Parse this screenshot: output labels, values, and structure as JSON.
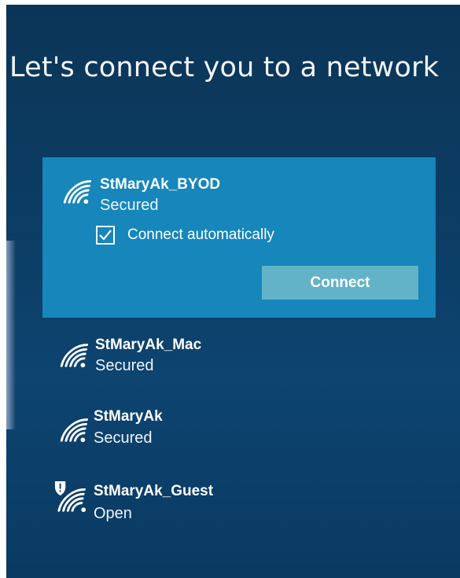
{
  "page": {
    "title": "Let's connect you to a network"
  },
  "networks": [
    {
      "name": "StMaryAk_BYOD",
      "status": "Secured",
      "icon": "wifi-signal-icon",
      "selected": true,
      "connect_automatically": {
        "label": "Connect automatically",
        "checked": true
      },
      "connect_button": "Connect"
    },
    {
      "name": "StMaryAk_Mac",
      "status": "Secured",
      "icon": "wifi-signal-icon"
    },
    {
      "name": "StMaryAk",
      "status": "Secured",
      "icon": "wifi-signal-icon"
    },
    {
      "name": "StMaryAk_Guest",
      "status": "Open",
      "icon": "wifi-open-shield-icon"
    }
  ],
  "colors": {
    "background": "#0c3c63",
    "selected_item": "#1686bb",
    "connect_button": "#62b3c8",
    "text": "#ffffff"
  }
}
